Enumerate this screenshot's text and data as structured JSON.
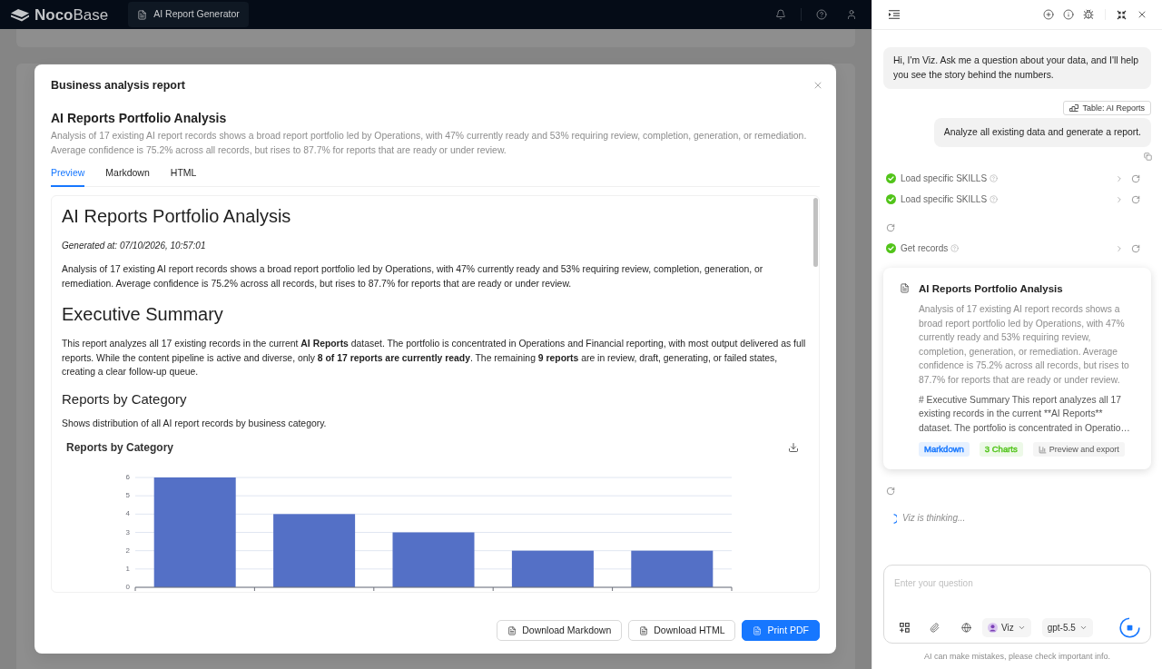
{
  "top_bar": {
    "logo": "**Noco**Base",
    "tab": {
      "label": "AI Report Generator",
      "selected": true
    }
  },
  "dialog": {
    "title": "Business analysis report",
    "report_title": "AI Reports Portfolio Analysis",
    "summary": "Analysis of 17 existing AI report records shows a broad report portfolio led by Operations, with 47% currently ready and 53% requiring review, completion, generation, or remediation. Average confidence is 75.2% across all records, but rises to 87.7% for reports that are ready or under review.",
    "tabs": [
      {
        "label": "Preview",
        "selected": true
      },
      {
        "label": "Markdown",
        "selected": false
      },
      {
        "label": "HTML",
        "selected": false
      }
    ],
    "preview": [
      {
        "kind": "heading1",
        "text": "AI Reports Portfolio Analysis"
      },
      {
        "kind": "meta",
        "text": "Generated at: 07/10/2026, 10:57:01"
      },
      {
        "kind": "paragraph",
        "text": "Analysis of 17 existing AI report records shows a broad report portfolio led by Operations, with 47% currently ready and 53% requiring review, completion, generation, or remediation. Average confidence is 75.2% across all records, but rises to 87.7% for reports that are ready or under review."
      },
      {
        "kind": "heading1",
        "text": "Executive Summary"
      },
      {
        "kind": "paragraph",
        "text": "This report analyzes all 17 existing records in the current **AI Reports** dataset. The portfolio is concentrated in Operations and Financial reporting, with most output delivered as full reports. While the content pipeline is active and diverse, only **8 of 17 reports are currently ready**. The remaining **9 reports** are in review, draft, generating, or failed states, creating a clear follow-up queue."
      },
      {
        "kind": "heading2",
        "text": "Reports by Category"
      },
      {
        "kind": "paragraph",
        "text": "Shows distribution of all AI report records by business category."
      },
      {
        "kind": "chart",
        "chart_data": {
          "type": "bar",
          "title": "Reports by Category",
          "values": [
            6,
            4,
            3,
            2,
            2
          ],
          "ylim": [
            0,
            6
          ],
          "yticks": [
            0,
            1,
            2,
            3,
            4,
            5,
            6
          ],
          "grid": true
        }
      }
    ],
    "buttons": [
      {
        "label": "Download Markdown",
        "kind": "default"
      },
      {
        "label": "Download HTML",
        "kind": "default"
      },
      {
        "label": "Print PDF",
        "kind": "primary"
      }
    ]
  },
  "assistant": {
    "messages": [
      {
        "kind": "assistant",
        "text": "Hi, I'm Viz. Ask me a question about your data, and I'll help you see the story behind the numbers."
      },
      {
        "kind": "context",
        "text": "Table: AI Reports"
      },
      {
        "kind": "user",
        "text": "Analyze all existing data and generate a report."
      },
      {
        "kind": "tool",
        "label": "Load specific SKILLS",
        "done": true
      },
      {
        "kind": "tool",
        "label": "Load specific SKILLS",
        "done": true
      },
      {
        "kind": "loading"
      },
      {
        "kind": "tool",
        "label": "Get records",
        "done": true
      },
      {
        "kind": "report",
        "title": "AI Reports Portfolio Analysis",
        "summary": "Analysis of 17 existing AI report records shows a broad report portfolio led by Operations, with 47% currently ready and 53% requiring review, completion, generation, or remediation. Average confidence is 75.2% across all records, but rises to 87.7% for reports that are ready or under review.",
        "excerpt": "# Executive Summary This report analyzes all 17 existing records in the current **AI Reports** dataset. The portfolio is concentrated in Operatio…",
        "tags": [
          {
            "label": "Markdown",
            "color": "#1677ff"
          },
          {
            "label": "3 Charts",
            "color": "#52c41a"
          }
        ],
        "action": "Preview and export"
      },
      {
        "kind": "loading"
      },
      {
        "kind": "thinking",
        "text": "Viz is thinking..."
      }
    ],
    "input": {
      "placeholder": "Enter your question",
      "agent": "Viz",
      "model": "gpt-5.5"
    },
    "disclaimer": "AI can make mistakes, please check important info."
  }
}
